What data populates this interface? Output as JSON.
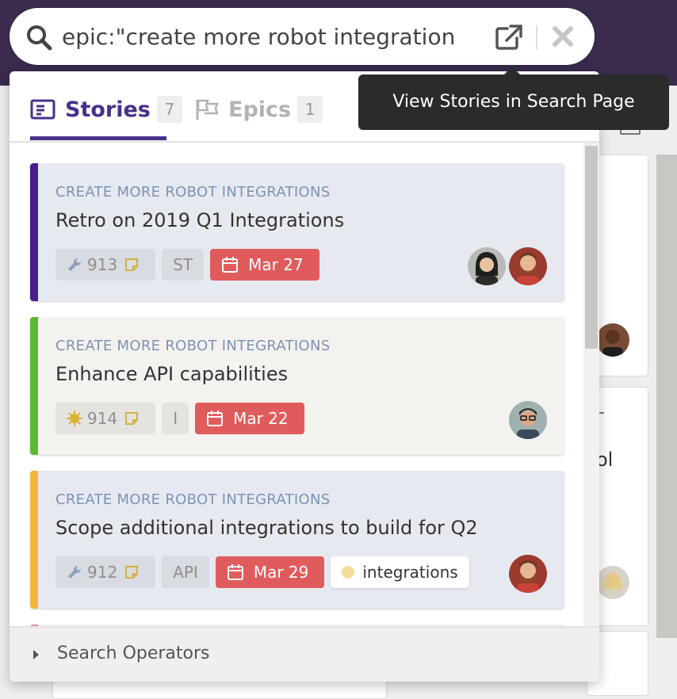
{
  "search": {
    "query": "epic:\"create more robot integration",
    "external_tooltip": "View Stories in Search Page"
  },
  "tabs": [
    {
      "label": "Stories",
      "count": "7",
      "active": true,
      "icon": "story-list-icon"
    },
    {
      "label": "Epics",
      "count": "1",
      "active": false,
      "icon": "flags-icon"
    }
  ],
  "cards": [
    {
      "epic": "CREATE MORE ROBOT INTEGRATIONS",
      "title": "Retro on 2019 Q1 Integrations",
      "id": "913",
      "story_type_icon": "wrench-icon",
      "type_label": "ST",
      "due": "Mar 27",
      "label": "",
      "accent": "#4a1f8c",
      "bg": "#e6e9f0"
    },
    {
      "epic": "CREATE MORE ROBOT INTEGRATIONS",
      "title": "Enhance API capabilities",
      "id": "914",
      "story_type_icon": "feature-icon",
      "type_label": "I",
      "due": "Mar 22",
      "label": "",
      "accent": "#5cb832",
      "bg": "#f3f2ef"
    },
    {
      "epic": "CREATE MORE ROBOT INTEGRATIONS",
      "title": "Scope additional integrations to build for Q2",
      "id": "912",
      "story_type_icon": "wrench-icon",
      "type_label": "API",
      "due": "Mar 29",
      "label": "integrations",
      "accent": "#f5b63c",
      "bg": "#e6e9f0"
    }
  ],
  "footer": {
    "label": "Search Operators"
  },
  "background": {
    "partial_text": "ol"
  },
  "colors": {
    "accent_purple": "#4a2f8a",
    "due_red": "#e05c5c",
    "epic_blue": "#7d93b3",
    "tooltip_bg": "#2b2b2b"
  }
}
